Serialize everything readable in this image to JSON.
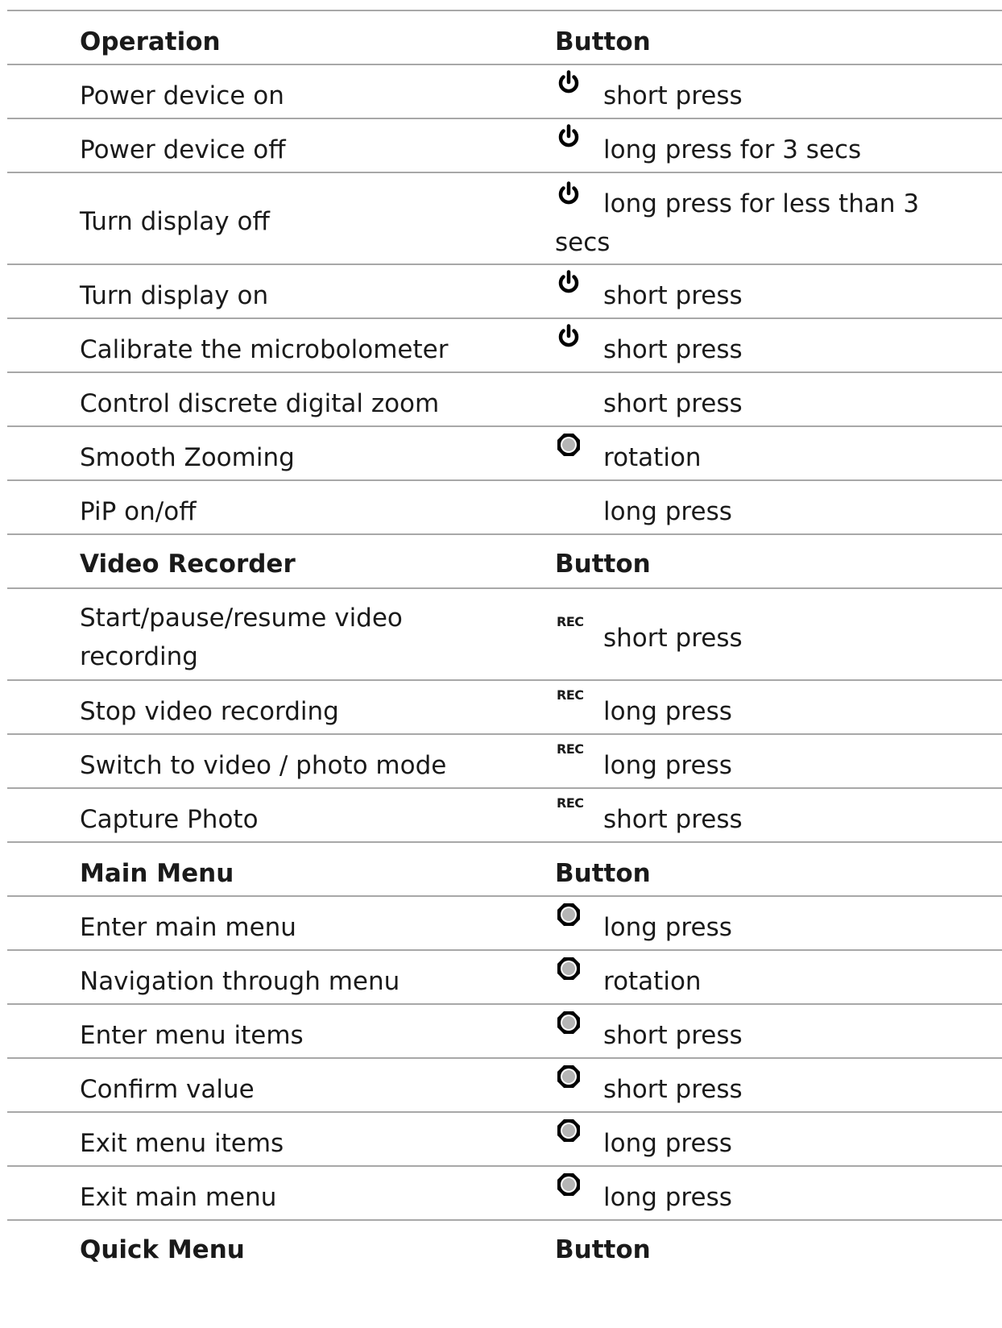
{
  "table": {
    "sections": [
      {
        "heading": {
          "operation": "Operation",
          "button": "Button"
        },
        "rows": [
          {
            "operation": "Power device on",
            "icon": "power-icon",
            "action": "short press"
          },
          {
            "operation": "Power device off",
            "icon": "power-icon",
            "action": "long press for 3 secs"
          },
          {
            "operation": "Turn display off",
            "icon": "power-icon",
            "action": "long press for less than 3 secs"
          },
          {
            "operation": "Turn display on",
            "icon": "power-icon",
            "action": "short press"
          },
          {
            "operation": "Calibrate the microbolometer",
            "icon": "power-icon",
            "action": "short press"
          },
          {
            "operation": "Control discrete digital zoom",
            "icon": "",
            "action": "short press"
          },
          {
            "operation": "Smooth Zooming",
            "icon": "controller-dial-icon",
            "action": "rotation"
          },
          {
            "operation": "PiP on/off",
            "icon": "",
            "action": "long press"
          }
        ]
      },
      {
        "heading": {
          "operation": "Video Recorder",
          "button": "Button"
        },
        "rows": [
          {
            "operation": "Start/pause/resume video recording",
            "icon": "rec-icon",
            "icon_label": "REC",
            "action": "short press"
          },
          {
            "operation": "Stop video recording",
            "icon": "rec-icon",
            "icon_label": "REC",
            "action": "long press"
          },
          {
            "operation": "Switch to video / photo mode",
            "icon": "rec-icon",
            "icon_label": "REC",
            "action": "long press"
          },
          {
            "operation": "Capture Photo",
            "icon": "rec-icon",
            "icon_label": "REC",
            "action": "short press"
          }
        ]
      },
      {
        "heading": {
          "operation": "Main Menu",
          "button": "Button"
        },
        "rows": [
          {
            "operation": "Enter main menu",
            "icon": "controller-dial-icon",
            "action": "long press"
          },
          {
            "operation": "Navigation through menu",
            "icon": "controller-dial-icon",
            "action": "rotation"
          },
          {
            "operation": "Enter menu items",
            "icon": "controller-dial-icon",
            "action": "short press"
          },
          {
            "operation": "Confirm value",
            "icon": "controller-dial-icon",
            "action": "short press"
          },
          {
            "operation": "Exit menu items",
            "icon": "controller-dial-icon",
            "action": "long press"
          },
          {
            "operation": "Exit main menu",
            "icon": "controller-dial-icon",
            "action": "long press"
          }
        ]
      },
      {
        "heading": {
          "operation": "Quick Menu",
          "button": "Button"
        },
        "rows": []
      }
    ]
  }
}
